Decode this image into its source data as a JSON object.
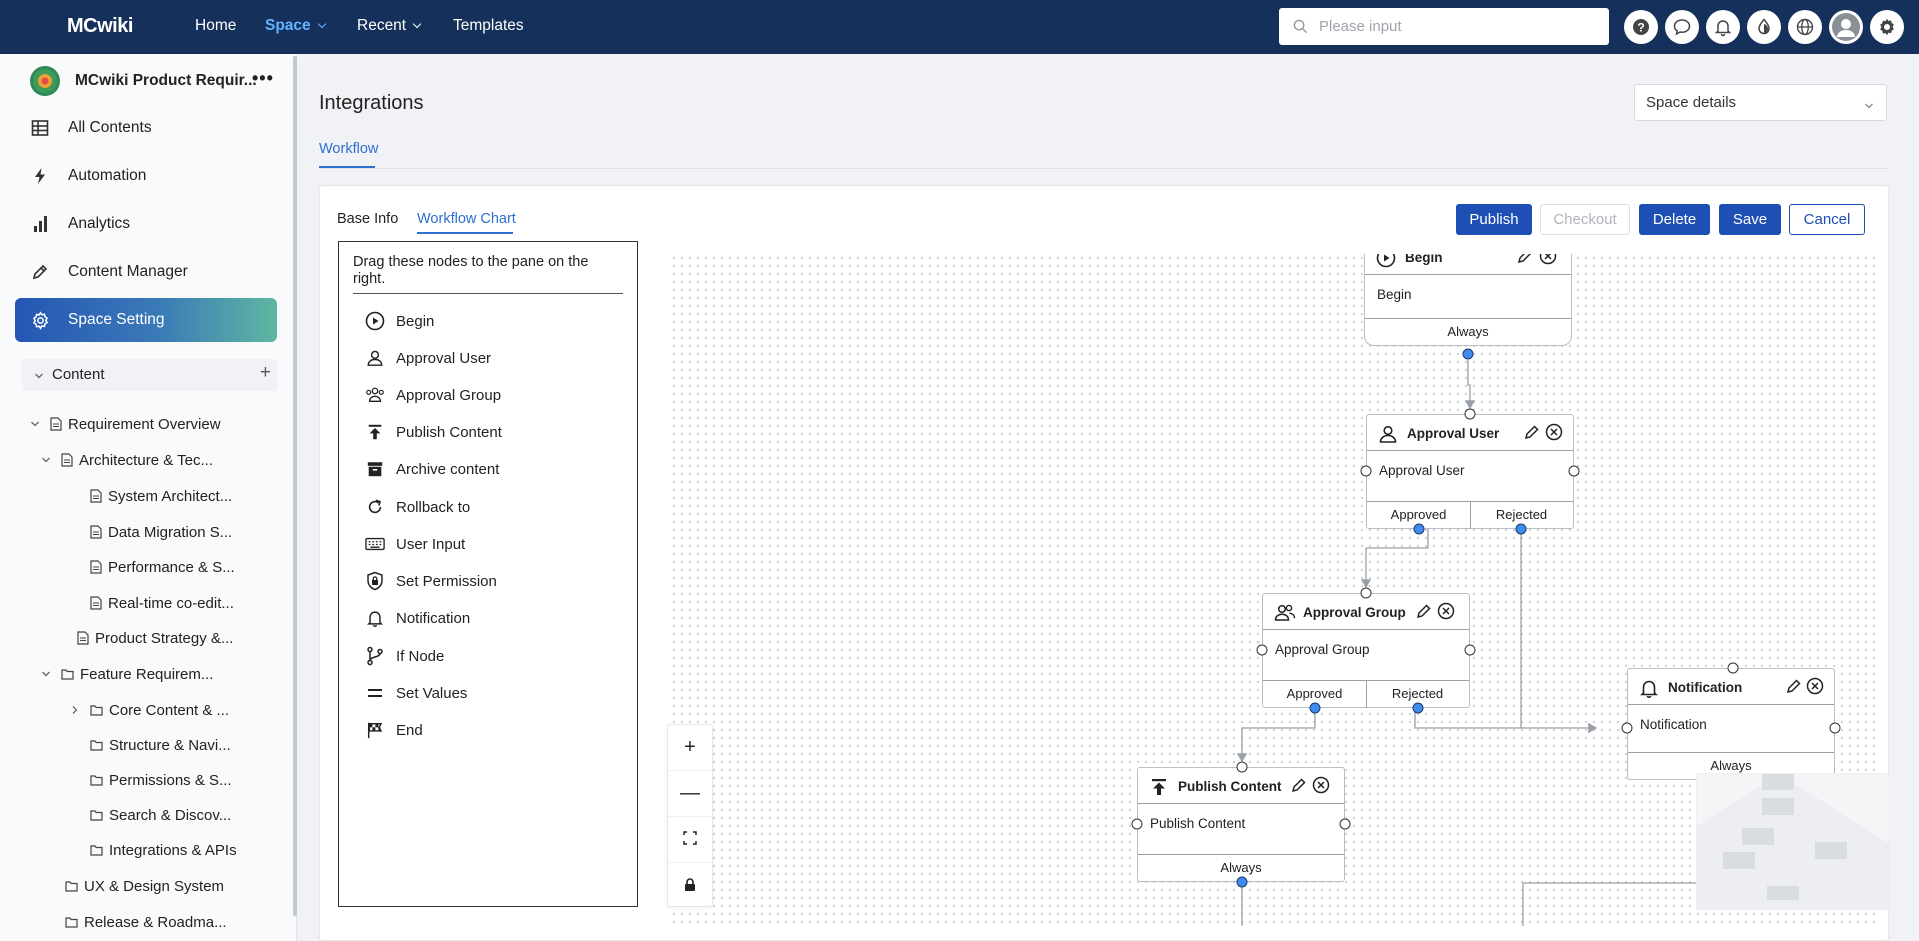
{
  "topbar": {
    "brand": "MCwiki",
    "nav": [
      "Home",
      "Space",
      "Recent",
      "Templates"
    ],
    "search_placeholder": "Please input",
    "icons": [
      "help-icon",
      "chat-icon",
      "bell-icon",
      "theme-icon",
      "globe-icon",
      "avatar",
      "gear-icon"
    ]
  },
  "sidebar": {
    "space_name": "MCwiki Product Requir...",
    "more": "•••",
    "items": [
      "All Contents",
      "Automation",
      "Analytics",
      "Content Manager",
      "Space Setting"
    ],
    "active_item": "Space Setting",
    "tree_header": "Content",
    "tree": [
      "Requirement Overview",
      "Architecture & Tec...",
      "System Architect...",
      "Data Migration S...",
      "Performance & S...",
      "Real-time co-edit...",
      "Product Strategy &...",
      "Feature Requirem...",
      "Core Content & ...",
      "Structure & Navi...",
      "Permissions & S...",
      "Search & Discov...",
      "Integrations & APIs",
      "UX & Design System",
      "Release & Roadma..."
    ]
  },
  "main": {
    "title": "Integrations",
    "space_select": "Space details",
    "tab": "Workflow",
    "subtabs": [
      "Base Info",
      "Workflow Chart"
    ],
    "buttons": {
      "publish": "Publish",
      "checkout": "Checkout",
      "delete": "Delete",
      "save": "Save",
      "cancel": "Cancel"
    },
    "palette_hint": "Drag these nodes to the pane on the right.",
    "palette": [
      "Begin",
      "Approval User",
      "Approval Group",
      "Publish Content",
      "Archive content",
      "Rollback to",
      "User Input",
      "Set Permission",
      "Notification",
      "If Node",
      "Set Values",
      "End"
    ]
  },
  "workflow": {
    "nodes": {
      "begin": {
        "title": "Begin",
        "body": "Begin",
        "footer": "Always"
      },
      "approval_user": {
        "title": "Approval User",
        "body": "Approval User",
        "approved": "Approved",
        "rejected": "Rejected"
      },
      "approval_group": {
        "title": "Approval Group",
        "body": "Approval Group",
        "approved": "Approved",
        "rejected": "Rejected"
      },
      "notification": {
        "title": "Notification",
        "body": "Notification",
        "footer": "Always"
      },
      "publish": {
        "title": "Publish Content",
        "body": "Publish Content",
        "footer": "Always"
      }
    },
    "zoom_controls": [
      "+",
      "—"
    ]
  },
  "colors": {
    "topbar": "#15305b",
    "accent": "#2f6fd0",
    "primary_button": "#1e4fb4",
    "port_out": "#3f8cf0"
  }
}
